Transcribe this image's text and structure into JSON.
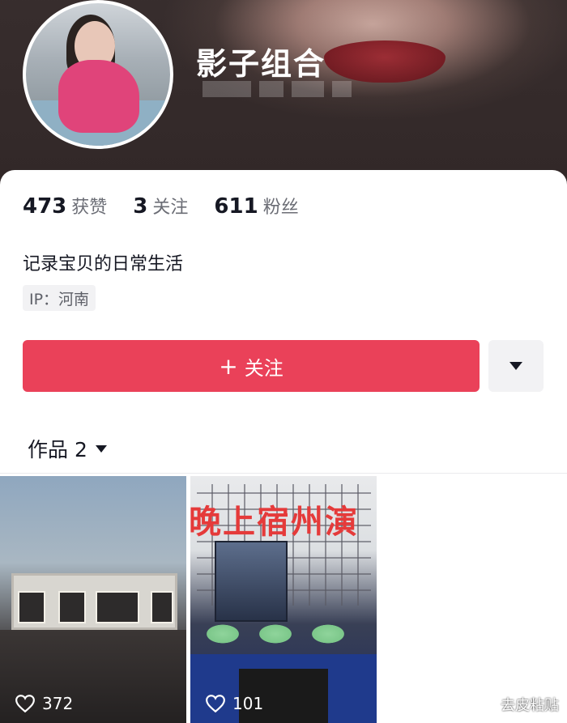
{
  "profile": {
    "username": "影子组合",
    "bio": "记录宝贝的日常生活",
    "ip_label": "IP：河南"
  },
  "stats": [
    {
      "value": "473",
      "label": "获赞"
    },
    {
      "value": "3",
      "label": "关注"
    },
    {
      "value": "611",
      "label": "粉丝"
    }
  ],
  "actions": {
    "follow_label": "关注",
    "follow_plus": "+"
  },
  "works": {
    "tab_label": "作品 2"
  },
  "videos": [
    {
      "likes": "372",
      "overlay_text": ""
    },
    {
      "likes": "101",
      "overlay_text": "晚上宿州演"
    }
  ],
  "watermark": "去皮粘贴",
  "colors": {
    "accent": "#ea4159",
    "text_primary": "#161823",
    "text_secondary": "#6b6d75"
  }
}
